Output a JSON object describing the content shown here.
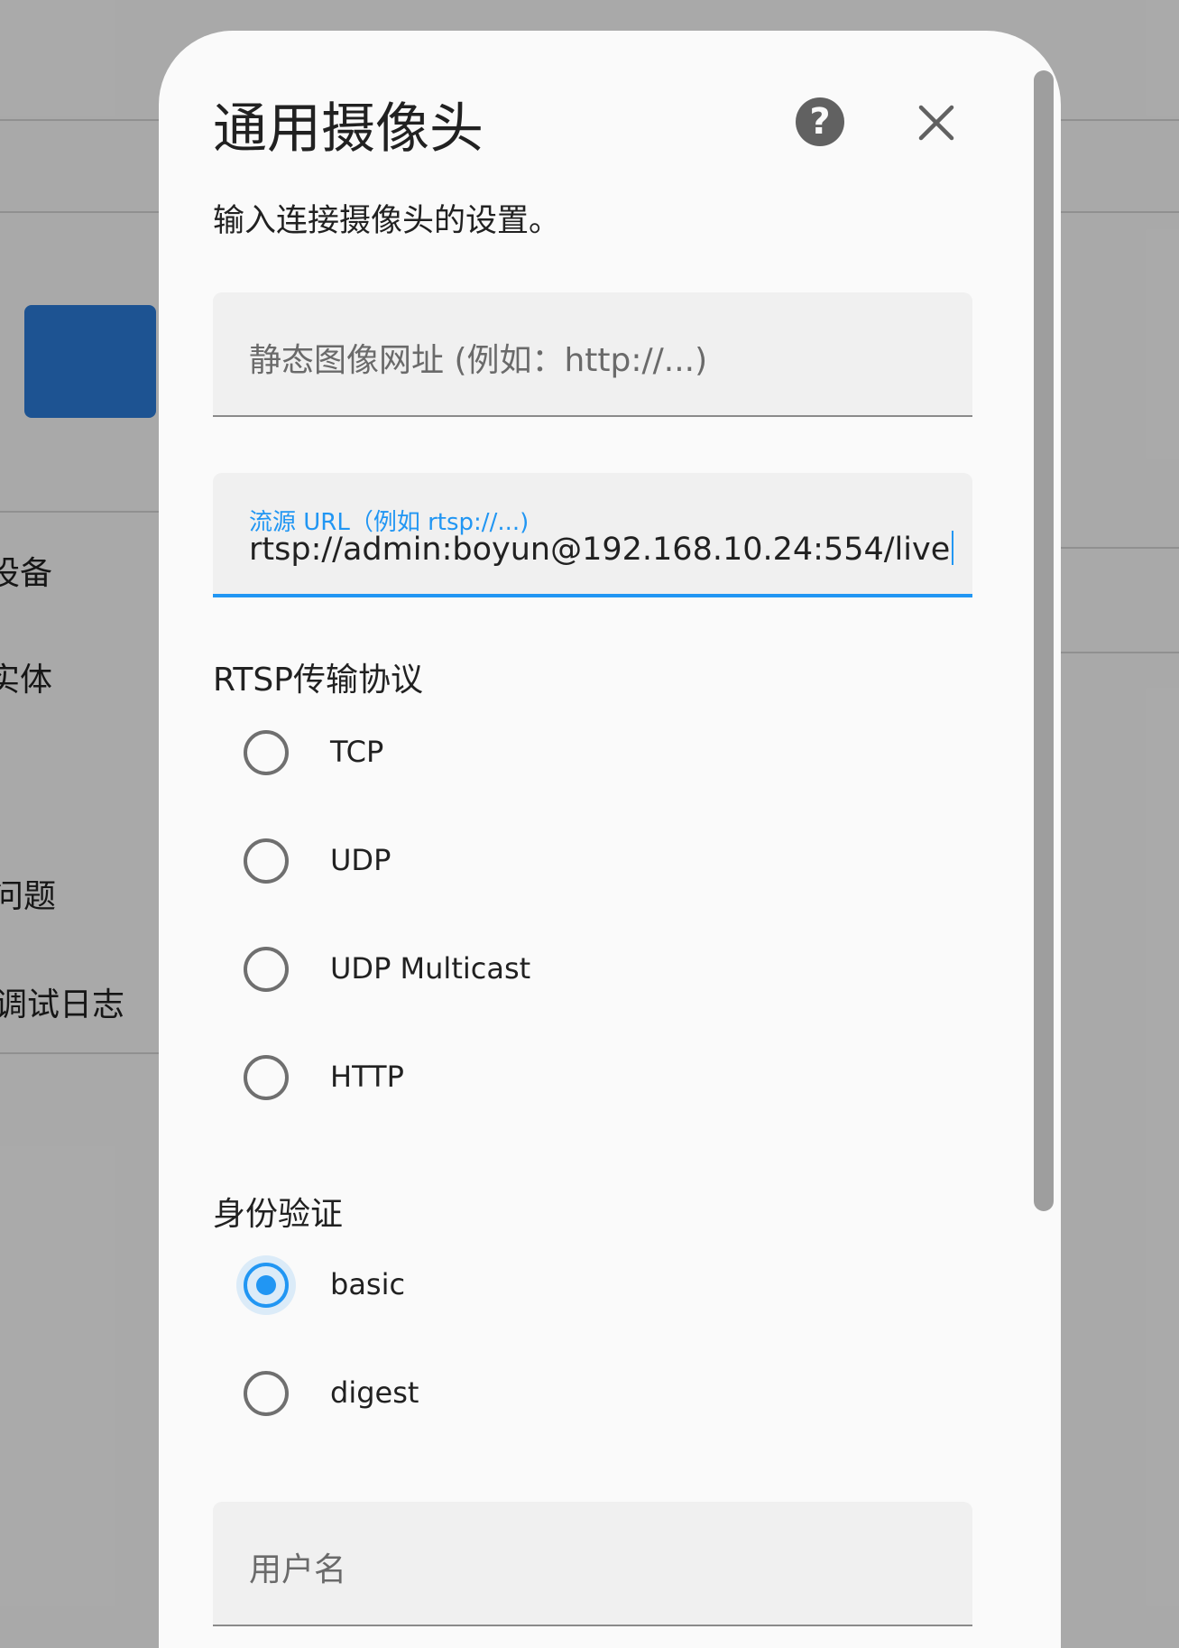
{
  "background": {
    "menu_items": [
      "设备",
      "实体",
      "问题",
      "调试日志"
    ],
    "accent_button_color": "#2b7bd8"
  },
  "dialog": {
    "title": "通用摄像头",
    "help_icon": "help-circle-icon",
    "help_glyph": "?",
    "close_icon": "close-icon",
    "description": "输入连接摄像头的设置。",
    "still_image_url": {
      "placeholder": "静态图像网址 (例如：http://...)",
      "value": ""
    },
    "stream_source": {
      "label": "流源 URL（例如 rtsp://...)",
      "value": "rtsp://admin:boyun@192.168.10.24:554/live"
    },
    "rtsp_transport": {
      "title": "RTSP传输协议",
      "options": [
        "TCP",
        "UDP",
        "UDP Multicast",
        "HTTP"
      ],
      "selected": null
    },
    "authentication": {
      "title": "身份验证",
      "options": [
        "basic",
        "digest"
      ],
      "selected": "basic"
    },
    "username": {
      "placeholder": "用户名",
      "value": ""
    },
    "accent_color": "#2196f3"
  }
}
